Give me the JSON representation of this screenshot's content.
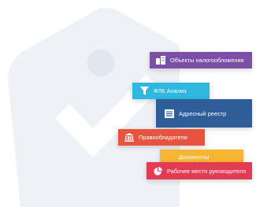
{
  "colors": {
    "background": "#ffffff",
    "illustration": "#eef1f6",
    "checkmark": "#ffffff",
    "tile_tax_objects": "#7b4fa6",
    "tile_fpk": "#2eb8e0",
    "tile_address_registry": "#2f5d9a",
    "tile_rights_holders": "#e8533d",
    "tile_documents": "#f7b531",
    "tile_manager_workspace": "#e23c55"
  },
  "tiles": [
    {
      "label": "Объекты налогообложения",
      "icon": "buildings-icon"
    },
    {
      "label": "ФЛК Анализ",
      "icon": "funnel-icon"
    },
    {
      "label": "Адресный реестр",
      "icon": "list-icon"
    },
    {
      "label": "Правообладатели",
      "icon": "bank-icon"
    },
    {
      "label": "Документы",
      "icon": "document-icon"
    },
    {
      "label": "Рабочее место руководителя",
      "icon": "pie-chart-icon"
    }
  ]
}
